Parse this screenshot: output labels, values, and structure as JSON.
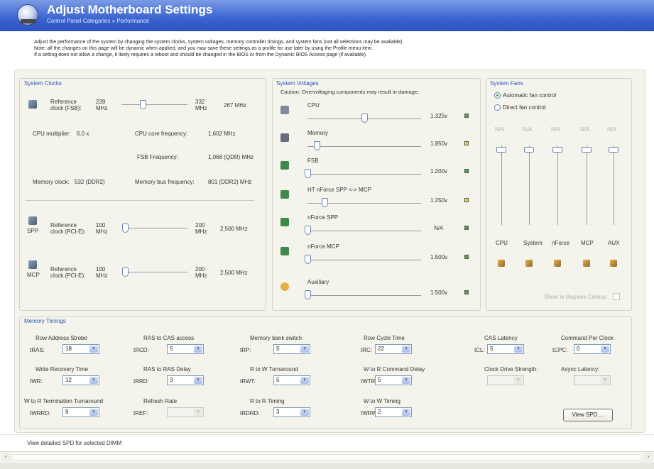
{
  "header": {
    "title": "Adjust Motherboard Settings",
    "breadcrumb": "Control Panel Categories  »  Performance",
    "icon": "motherboard-icon"
  },
  "description": [
    "Adjust the performance of the system by changing the system clocks, system voltages,  memory controller timings, and system fans (not all selections may be available).",
    "Note: all the changes on this page will be dynamic when applied, and you may save these settings as a profile for use later by using the Profile menu item.",
    "If a setting does not allow a change, it likely requires a reboot and should be changed in the BIOS or from the Dynamic BIOS Access page (if available)."
  ],
  "clocks": {
    "title": "System Clocks",
    "fsb": {
      "label": "Reference clock (FSB):",
      "min": "239 MHz",
      "max": "332 MHz",
      "value": "267 MHz",
      "position": 0.35
    },
    "cpu_multiplier": {
      "label": "CPU multiplier:",
      "value": "6.0 x"
    },
    "cpu_core": {
      "label": "CPU core frequency:",
      "value": "1,602 MHz"
    },
    "fsb_freq": {
      "label": "FSB Frequency:",
      "value": "1,068 (QDR) MHz"
    },
    "mem_clock": {
      "label": "Memory clock:",
      "value": "532 (DDR2)"
    },
    "mem_bus": {
      "label": "Memory bus frequency:",
      "value": "801 (DDR2) MHz"
    },
    "spp": {
      "tag": "SPP",
      "label": "Reference clock (PCI-E):",
      "min": "100 MHz",
      "max": "200 MHz",
      "value": "2,500 MHz",
      "position": 0.0
    },
    "mcp": {
      "tag": "MCP",
      "label": "Reference clock (PCI-E):",
      "min": "100 MHz",
      "max": "200 MHz",
      "value": "2,500 MHz",
      "position": 0.0
    }
  },
  "voltages": {
    "title": "System Voltages",
    "caution": "Caution: Overvoltaging components may result in damage.",
    "items": [
      {
        "label": "CPU",
        "value": "1.325v",
        "led": "#2fb52f",
        "position": 0.5
      },
      {
        "label": "Memory",
        "value": "1.850v",
        "led": "#e8d820",
        "position": 0.08
      },
      {
        "label": "FSB",
        "value": "1.200v",
        "led": "#2fb52f",
        "position": 0.0
      },
      {
        "label": "HT nForce SPP <-> MCP",
        "value": "1.250v",
        "led": "#e8d820",
        "position": 0.15
      },
      {
        "label": "nForce SPP",
        "value": "N/A",
        "led": "#2fb52f",
        "position": 0.0
      },
      {
        "label": "nForce MCP",
        "value": "1.500v",
        "led": "#2fb52f",
        "position": 0.0
      },
      {
        "label": "Auxiliary",
        "value": "1.500v",
        "led": "#2fb52f",
        "position": 0.0
      }
    ]
  },
  "fans": {
    "title": "System Fans",
    "auto_label": "Automatic fan control",
    "direct_label": "Direct fan control",
    "selected": "auto",
    "items": [
      {
        "value": "N/A",
        "label": "CPU"
      },
      {
        "value": "N/A",
        "label": "System"
      },
      {
        "value": "N/A",
        "label": "nForce"
      },
      {
        "value": "N/A",
        "label": "MCP"
      },
      {
        "value": "N/A",
        "label": "AUX"
      }
    ],
    "celsius_label": "Show in degrees Celsius"
  },
  "timings": {
    "title": "Memory Timings",
    "rows": [
      [
        {
          "title": "Row Address Strobe",
          "abbr": "tRAS:",
          "value": "18",
          "enabled": true
        },
        {
          "title": "RAS to CAS access",
          "abbr": "tRCD:",
          "value": "5",
          "enabled": true
        },
        {
          "title": "Memory bank switch",
          "abbr": "tRP:",
          "value": "5",
          "enabled": true
        },
        {
          "title": "Row Cycle Time",
          "abbr": "tRC:",
          "value": "22",
          "enabled": true
        },
        {
          "title": "CAS Latency",
          "abbr": "tCL:",
          "value": "5",
          "enabled": true
        },
        {
          "title": "Command Per Clock",
          "abbr": "tCPC:",
          "value": "0",
          "enabled": true
        }
      ],
      [
        {
          "title": "Write Recovery Time",
          "abbr": "tWR:",
          "value": "12",
          "enabled": true
        },
        {
          "title": "RAS to RAS Delay",
          "abbr": "tRRD:",
          "value": "3",
          "enabled": true
        },
        {
          "title": "R to W Turnaround",
          "abbr": "tRWT:",
          "value": "5",
          "enabled": true
        },
        {
          "title": "W to R Command Delay",
          "abbr": "tWTR:",
          "value": "5",
          "enabled": true
        },
        {
          "title": "Clock Drive Strength:",
          "abbr": "",
          "value": "",
          "enabled": false
        },
        {
          "title": "Async Latency:",
          "abbr": "",
          "value": "",
          "enabled": false
        }
      ],
      [
        {
          "title": "W to R Termination Turnaround",
          "abbr": "tWRRD:",
          "value": "9",
          "enabled": true
        },
        {
          "title": "Refresh Rate",
          "abbr": "tREF:",
          "value": "",
          "enabled": false
        },
        {
          "title": "R to R Timing",
          "abbr": "tRDRD:",
          "value": "3",
          "enabled": true
        },
        {
          "title": "W to W Timing",
          "abbr": "tWRWR:",
          "value": "2",
          "enabled": true
        }
      ]
    ],
    "view_spd": "View SPD ..."
  },
  "status": {
    "text": "View detailed SPD for selected DIMM"
  }
}
